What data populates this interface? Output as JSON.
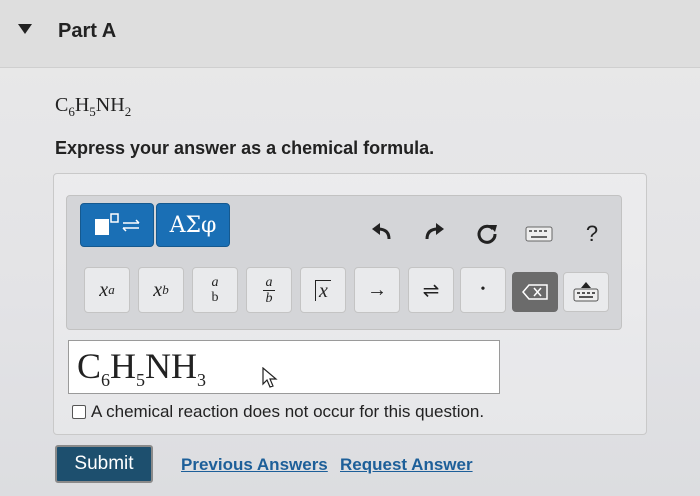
{
  "part": {
    "title": "Part A"
  },
  "question": {
    "formula_parts": [
      "C",
      "6",
      "H",
      "5",
      "NH",
      "2"
    ],
    "instructions": "Express your answer as a chemical formula."
  },
  "toolbar": {
    "greek_label": "ΑΣφ",
    "help_label": "?",
    "symbols": {
      "superscript_base": "x",
      "superscript_exp": "a",
      "subscript_base": "x",
      "subscript_sub": "b",
      "frac_num": "a",
      "frac_den": "b",
      "mixed_num": "a",
      "mixed_den": "b",
      "abs_label": "x",
      "arrow_label": "→",
      "equilibrium_label": "⇌",
      "dot_label": "•"
    }
  },
  "answer": {
    "parts": [
      "C",
      "6",
      "H",
      "5",
      "NH",
      "3"
    ]
  },
  "no_reaction": {
    "label": "A chemical reaction does not occur for this question."
  },
  "actions": {
    "submit_label": "Submit",
    "previous_answers_label": "Previous Answers",
    "request_answer_label": "Request Answer"
  },
  "colors": {
    "accent_blue": "#1a6fb5",
    "submit_bg": "#1d4f6e",
    "link": "#1d5f99"
  }
}
